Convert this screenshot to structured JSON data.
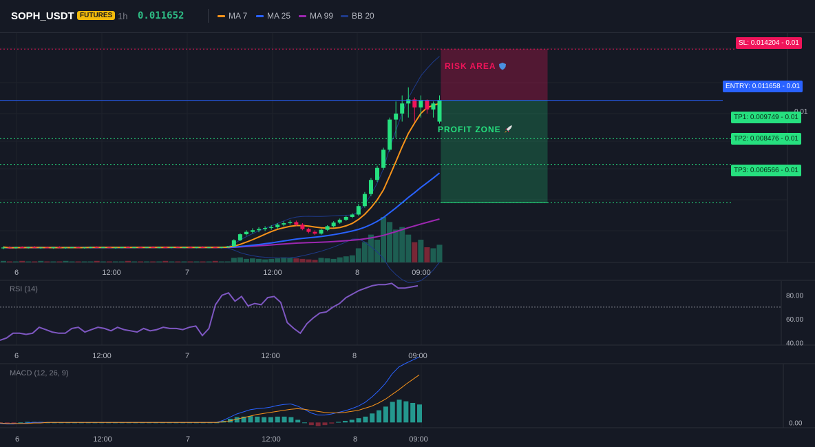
{
  "header": {
    "symbol": "SOPH_USDT",
    "badge": "FUTURES",
    "timeframe": "1h",
    "last_price": "0.011652",
    "legend": [
      {
        "label": "MA 7",
        "color": "#f7931a"
      },
      {
        "label": "MA 25",
        "color": "#2962ff"
      },
      {
        "label": "MA 99",
        "color": "#9c27b0"
      },
      {
        "label": "BB 20",
        "color": "#1e3a8a"
      }
    ]
  },
  "colors": {
    "up": "#26e07f",
    "down": "#f0145a",
    "entry": "#2962ff",
    "sl": "#f0145a",
    "tp": "#26e07f",
    "rsi": "#7e57c2",
    "macd_line": "#2962ff",
    "signal_line": "#f7931a",
    "hist_up": "#26a69a"
  },
  "trade": {
    "sl_label": "SL: 0.014204",
    "entry_label": "ENTRY: 0.011658",
    "tp1_label": "TP1: 0.009749",
    "tp2_label": "TP2: 0.008476",
    "tp3_label": "TP3: 0.006566",
    "qty": "0.01",
    "risk_label": "RISK AREA",
    "risk_icon": "shield-icon",
    "profit_label": "PROFIT ZONE",
    "profit_icon": "rocket-icon"
  },
  "chart_data": [
    {
      "type": "candlestick",
      "title": "SOPH_USDT",
      "x_tick_labels": [
        "6",
        "12:00",
        "7",
        "12:00",
        "8",
        "09:00"
      ],
      "ylim": [
        0.0036,
        0.015
      ],
      "candles": [
        [
          0.0043,
          0.0044,
          0.00426,
          0.00434
        ],
        [
          0.00434,
          0.0044,
          0.00428,
          0.00432
        ],
        [
          0.00432,
          0.00438,
          0.00428,
          0.00435
        ],
        [
          0.00435,
          0.0044,
          0.0043,
          0.00433
        ],
        [
          0.00433,
          0.00438,
          0.00429,
          0.00436
        ],
        [
          0.00436,
          0.00441,
          0.00431,
          0.00433
        ],
        [
          0.00433,
          0.00437,
          0.00428,
          0.00434
        ],
        [
          0.00434,
          0.00439,
          0.0043,
          0.00432
        ],
        [
          0.00432,
          0.00436,
          0.00428,
          0.00435
        ],
        [
          0.00435,
          0.0044,
          0.00431,
          0.00433
        ],
        [
          0.00433,
          0.00437,
          0.00429,
          0.00434
        ],
        [
          0.00434,
          0.00438,
          0.0043,
          0.00435
        ],
        [
          0.00435,
          0.00439,
          0.00431,
          0.00433
        ],
        [
          0.00433,
          0.00437,
          0.00429,
          0.00434
        ],
        [
          0.00434,
          0.00438,
          0.0043,
          0.00436
        ],
        [
          0.00436,
          0.0044,
          0.00432,
          0.00434
        ],
        [
          0.00434,
          0.00438,
          0.0043,
          0.00435
        ],
        [
          0.00435,
          0.00439,
          0.00431,
          0.00433
        ],
        [
          0.00433,
          0.00437,
          0.00429,
          0.00434
        ],
        [
          0.00434,
          0.00438,
          0.0043,
          0.00436
        ],
        [
          0.00436,
          0.0044,
          0.00432,
          0.00434
        ],
        [
          0.00434,
          0.00438,
          0.0043,
          0.00435
        ],
        [
          0.00435,
          0.00439,
          0.00431,
          0.00434
        ],
        [
          0.00434,
          0.00438,
          0.0043,
          0.00436
        ],
        [
          0.00436,
          0.0044,
          0.00432,
          0.00434
        ],
        [
          0.00434,
          0.00438,
          0.0043,
          0.00435
        ],
        [
          0.00435,
          0.00439,
          0.00431,
          0.00434
        ],
        [
          0.00434,
          0.00438,
          0.0043,
          0.00436
        ],
        [
          0.00436,
          0.0044,
          0.00432,
          0.00434
        ],
        [
          0.00434,
          0.00438,
          0.0043,
          0.00435
        ],
        [
          0.00435,
          0.00439,
          0.00431,
          0.00434
        ],
        [
          0.00434,
          0.00438,
          0.0043,
          0.00436
        ],
        [
          0.00436,
          0.0044,
          0.00432,
          0.00434
        ],
        [
          0.00434,
          0.00438,
          0.0043,
          0.00435
        ],
        [
          0.00435,
          0.00439,
          0.00431,
          0.00434
        ],
        [
          0.00434,
          0.00438,
          0.0043,
          0.00436
        ],
        [
          0.00436,
          0.00442,
          0.00432,
          0.0044
        ],
        [
          0.0044,
          0.00475,
          0.00438,
          0.0047
        ],
        [
          0.0047,
          0.00505,
          0.00466,
          0.005
        ],
        [
          0.005,
          0.0052,
          0.00494,
          0.00512
        ],
        [
          0.00512,
          0.0053,
          0.00504,
          0.0052
        ],
        [
          0.0052,
          0.00535,
          0.0051,
          0.00526
        ],
        [
          0.00526,
          0.0054,
          0.00516,
          0.00531
        ],
        [
          0.00531,
          0.00545,
          0.00522,
          0.00535
        ],
        [
          0.00535,
          0.00555,
          0.00528,
          0.00548
        ],
        [
          0.00548,
          0.00565,
          0.0054,
          0.00555
        ],
        [
          0.00555,
          0.0057,
          0.00548,
          0.0056
        ],
        [
          0.0056,
          0.00568,
          0.00542,
          0.00548
        ],
        [
          0.00548,
          0.00555,
          0.0052,
          0.00526
        ],
        [
          0.00526,
          0.00532,
          0.00505,
          0.00512
        ],
        [
          0.00512,
          0.0052,
          0.00496,
          0.00503
        ],
        [
          0.00503,
          0.00528,
          0.00498,
          0.00522
        ],
        [
          0.00522,
          0.00545,
          0.00516,
          0.0054
        ],
        [
          0.0054,
          0.00565,
          0.00534,
          0.00558
        ],
        [
          0.00558,
          0.00578,
          0.00552,
          0.00572
        ],
        [
          0.00572,
          0.00592,
          0.00566,
          0.00586
        ],
        [
          0.00586,
          0.00605,
          0.0058,
          0.00598
        ],
        [
          0.00598,
          0.0065,
          0.00592,
          0.0064
        ],
        [
          0.0064,
          0.0071,
          0.00632,
          0.007
        ],
        [
          0.007,
          0.0078,
          0.0069,
          0.0077
        ],
        [
          0.0077,
          0.0084,
          0.0076,
          0.0083
        ],
        [
          0.0083,
          0.0093,
          0.0082,
          0.0092
        ],
        [
          0.0092,
          0.0108,
          0.0091,
          0.0107
        ],
        [
          0.0107,
          0.0116,
          0.0098,
          0.011
        ],
        [
          0.011,
          0.0119,
          0.0106,
          0.0115
        ],
        [
          0.0115,
          0.0123,
          0.0108,
          0.0117
        ],
        [
          0.0117,
          0.0118,
          0.0106,
          0.0113
        ],
        [
          0.0113,
          0.0119,
          0.0108,
          0.01165
        ],
        [
          0.01165,
          0.0117,
          0.011,
          0.0112
        ],
        [
          0.0112,
          0.0116,
          0.0108,
          0.0115
        ],
        [
          0.0106,
          0.0119,
          0.0105,
          0.01165
        ]
      ],
      "ma7_start": 0.00436,
      "volume": [
        3,
        2,
        2,
        3,
        2,
        2,
        3,
        2,
        2,
        2,
        3,
        2,
        2,
        2,
        2,
        3,
        2,
        2,
        2,
        2,
        3,
        2,
        2,
        2,
        2,
        2,
        3,
        2,
        2,
        2,
        2,
        2,
        2,
        2,
        3,
        2,
        2,
        9,
        10,
        7,
        8,
        7,
        6,
        7,
        8,
        10,
        9,
        8,
        7,
        6,
        5,
        9,
        8,
        7,
        10,
        12,
        14,
        28,
        40,
        55,
        45,
        90,
        80,
        65,
        70,
        55,
        40,
        45,
        30,
        28,
        35
      ],
      "price_labels": [
        "0.01"
      ]
    },
    {
      "type": "line",
      "title": "RSI (14)",
      "y_tick_labels": [
        "80.00",
        "60.00",
        "40.00"
      ],
      "ylim": [
        38,
        92
      ],
      "reference_line": 70,
      "values": [
        42,
        44,
        48,
        48,
        47,
        48,
        53,
        51,
        49,
        48,
        48,
        52,
        53,
        49,
        51,
        53,
        52,
        50,
        53,
        51,
        50,
        49,
        52,
        50,
        51,
        53,
        52,
        52,
        51,
        53,
        54,
        46,
        52,
        72,
        80,
        82,
        75,
        79,
        71,
        73,
        72,
        78,
        79,
        74,
        57,
        52,
        48,
        56,
        61,
        65,
        66,
        70,
        73,
        78,
        81,
        84,
        86,
        88,
        89,
        89,
        90,
        86,
        86,
        87,
        88
      ]
    },
    {
      "type": "line",
      "title": "MACD (12, 26, 9)",
      "y_tick_labels": [
        "0.00"
      ],
      "ylim": [
        -0.0001,
        0.0011
      ],
      "macd": [
        -2e-05,
        -3e-05,
        -3e-05,
        -2e-05,
        -1e-05,
        0,
        0,
        0,
        0,
        0,
        0,
        0,
        0,
        0,
        0,
        0,
        0,
        0,
        0,
        0,
        0,
        0,
        0,
        0,
        0,
        0,
        0,
        0,
        0,
        0,
        0,
        0,
        0,
        4e-05,
        0.0001,
        0.00016,
        0.0002,
        0.00024,
        0.00026,
        0.00027,
        0.00029,
        0.00032,
        0.00034,
        0.00035,
        0.00031,
        0.00025,
        0.00018,
        0.00014,
        0.00014,
        0.00016,
        0.00019,
        0.00022,
        0.00026,
        0.00031,
        0.00038,
        0.00048,
        0.0006,
        0.00074,
        0.00092,
        0.00105,
        0.00112,
        0.00118,
        0.00124
      ],
      "signal": [
        -1e-05,
        -2e-05,
        -2e-05,
        -2e-05,
        -2e-05,
        -1e-05,
        -1e-05,
        0,
        0,
        0,
        0,
        0,
        0,
        0,
        0,
        0,
        0,
        0,
        0,
        0,
        0,
        0,
        0,
        0,
        0,
        0,
        0,
        0,
        0,
        0,
        0,
        0,
        0,
        1e-05,
        3e-05,
        6e-05,
        9e-05,
        0.00012,
        0.00015,
        0.00017,
        0.00019,
        0.00021,
        0.00023,
        0.00025,
        0.00026,
        0.00025,
        0.00023,
        0.00021,
        0.00019,
        0.00018,
        0.00018,
        0.00019,
        0.00021,
        0.00023,
        0.00027,
        0.00031,
        0.00037,
        0.00044,
        0.00053,
        0.00062,
        0.00072,
        0.00081,
        0.0009
      ]
    }
  ]
}
